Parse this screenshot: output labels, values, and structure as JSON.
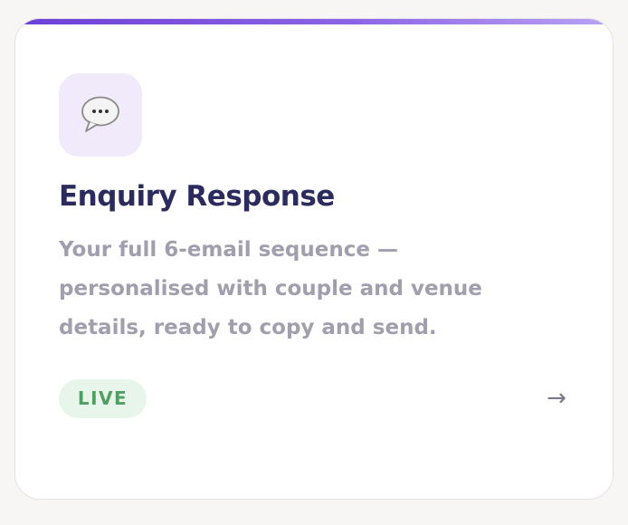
{
  "card": {
    "accent_gradient": [
      "#6d3fd6",
      "#8a63e6",
      "#b9a3f3"
    ],
    "icon": "speech-balloon-icon",
    "title": "Enquiry Response",
    "description": "Your full 6-email sequence — personalised with couple and venue details, ready to copy and send.",
    "badge": "LIVE",
    "arrow": "→"
  },
  "colors": {
    "title": "#2b2b5e",
    "description": "#a19fae",
    "badge_bg": "#e8f5ea",
    "badge_text": "#4f9e62",
    "icon_tile_bg": "#f0eafb"
  }
}
